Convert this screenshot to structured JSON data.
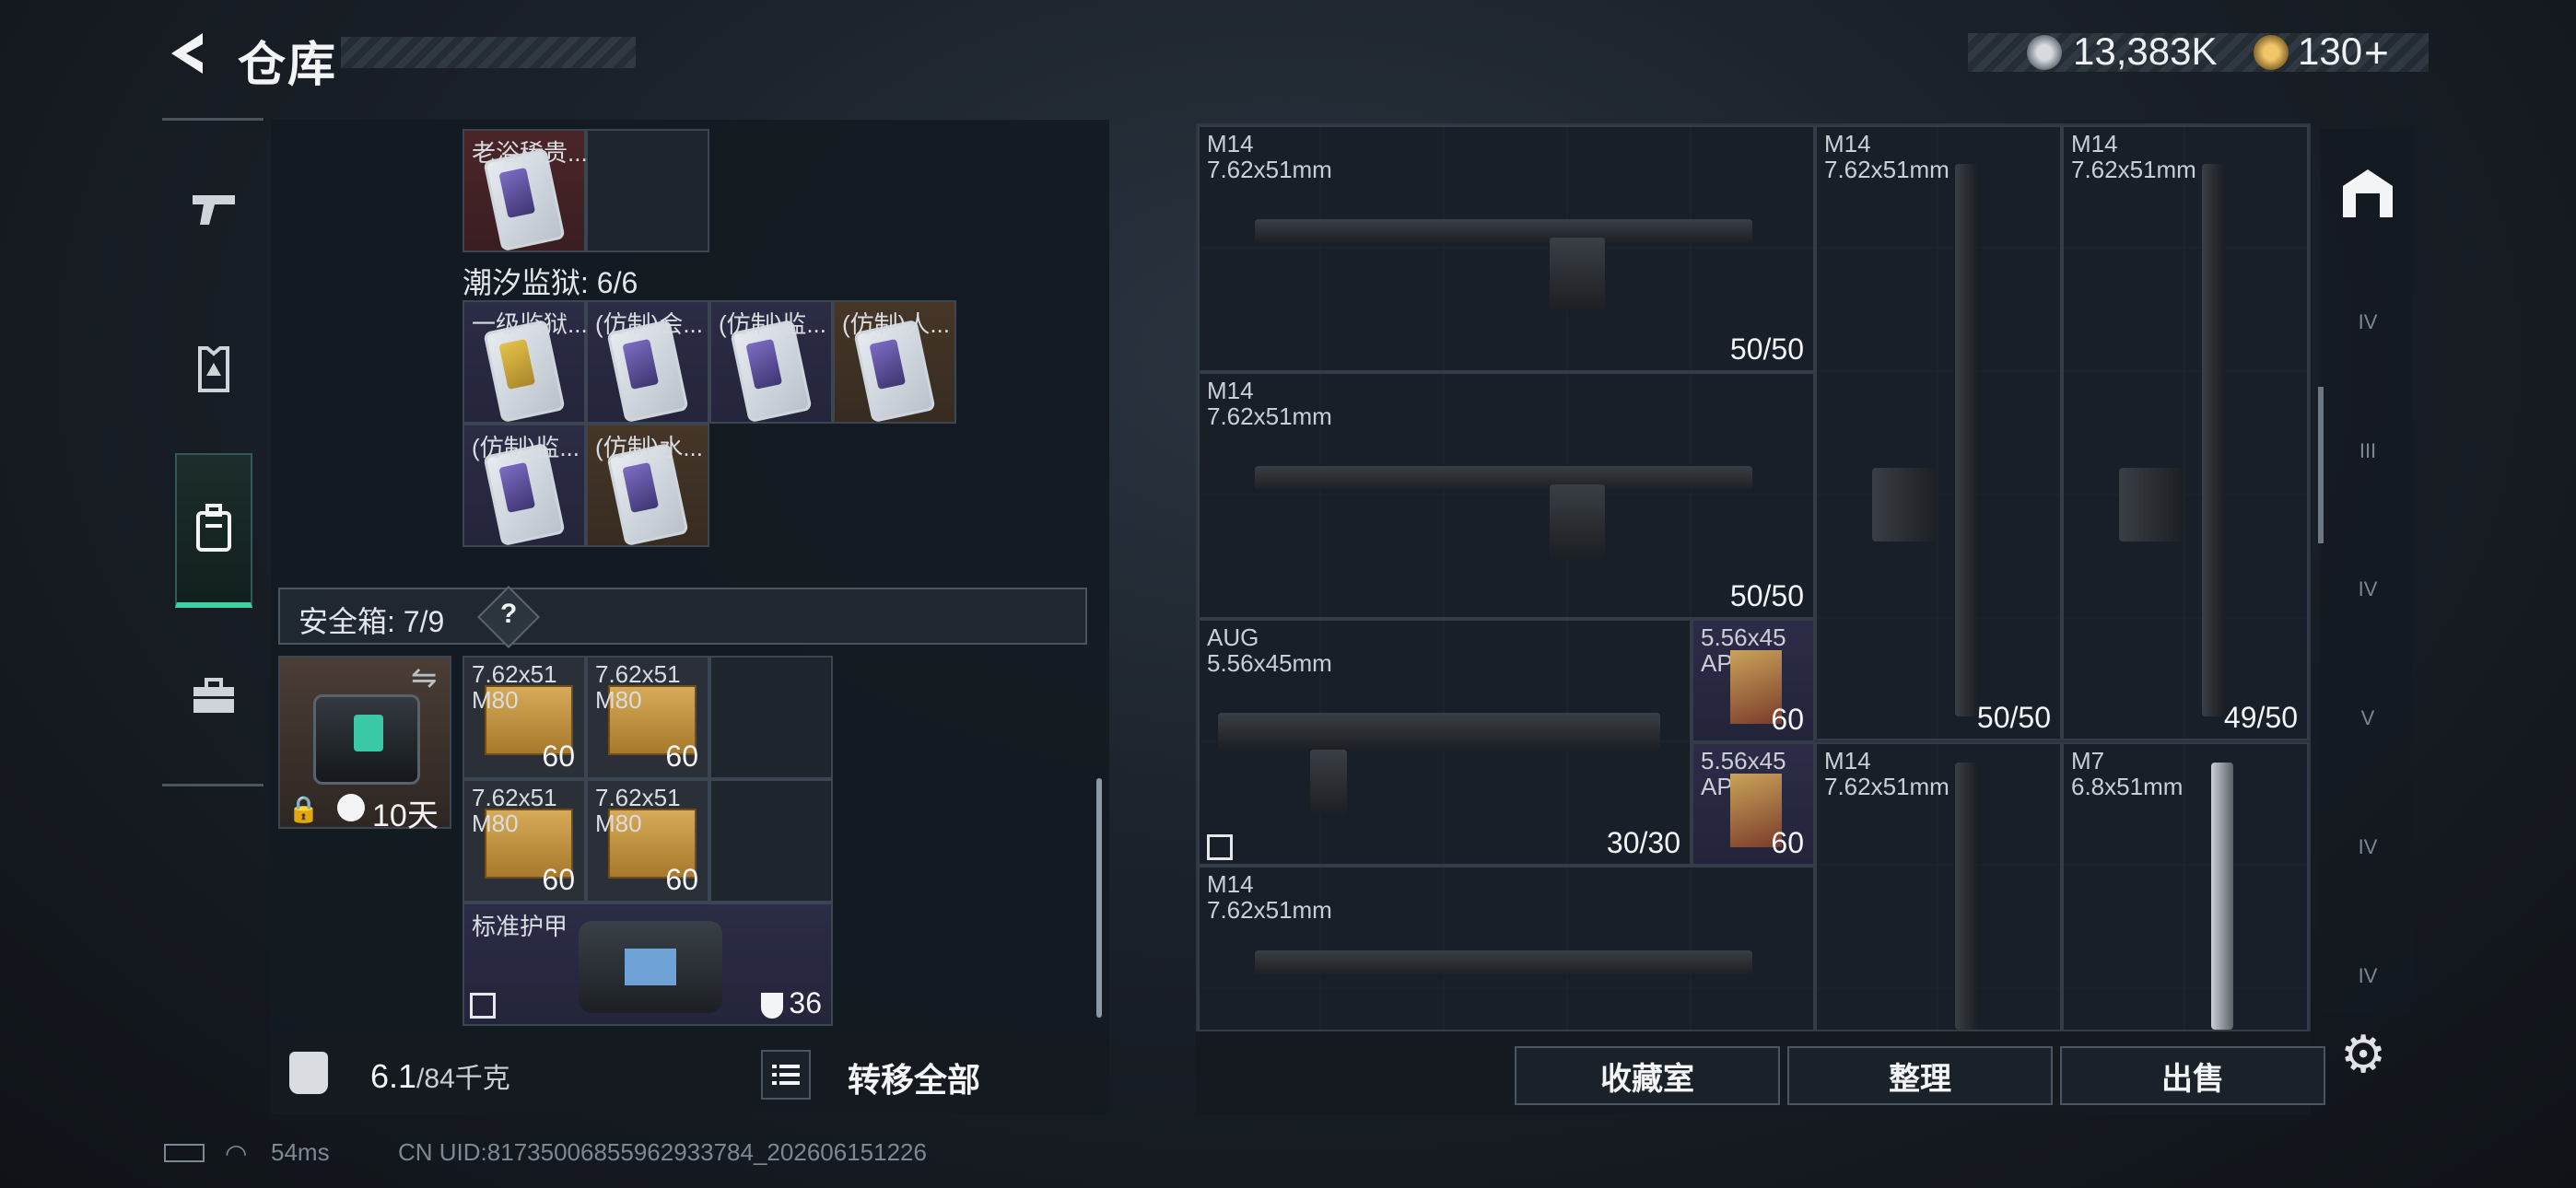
{
  "header": {
    "title": "仓库"
  },
  "currencies": [
    {
      "icon": "silver-coin-icon",
      "value": "13,383K"
    },
    {
      "icon": "gold-coin-icon",
      "value": "130"
    }
  ],
  "left_nav": [
    {
      "name": "weapons",
      "icon": "pistol-icon"
    },
    {
      "name": "gear",
      "icon": "armor-icon"
    },
    {
      "name": "backpack",
      "icon": "backpack-icon",
      "active": true
    },
    {
      "name": "toolbox",
      "icon": "toolbox-icon"
    }
  ],
  "backpack": {
    "top_item": {
      "label": "老浴稀贵..."
    },
    "prison_label": "潮汐监狱: 6/6",
    "prison_items": [
      {
        "label": "一级监狱...",
        "color": "purple",
        "accent": "gold"
      },
      {
        "label": "(仿制)会...",
        "color": "purple"
      },
      {
        "label": "(仿制)监...",
        "color": "purple"
      },
      {
        "label": "(仿制)人...",
        "color": "brown"
      },
      {
        "label": "(仿制)监...",
        "color": "purple"
      },
      {
        "label": "(仿制)水...",
        "color": "brown"
      }
    ],
    "safe_box": {
      "label": "安全箱: 7/9",
      "help": "?",
      "timer": "10天"
    },
    "safe_items": [
      {
        "caliber": "7.62x51",
        "type": "M80",
        "count": "60"
      },
      {
        "caliber": "7.62x51",
        "type": "M80",
        "count": "60"
      },
      {
        "caliber": "7.62x51",
        "type": "M80",
        "count": "60"
      },
      {
        "caliber": "7.62x51",
        "type": "M80",
        "count": "60"
      }
    ],
    "armor": {
      "label": "标准护甲",
      "durability": "36"
    },
    "weight": {
      "current": "6.1",
      "max": "/84千克"
    },
    "transfer_all": "转移全部"
  },
  "stash": {
    "items": [
      {
        "name": "M14",
        "caliber": "7.62x51mm",
        "count": "50/50"
      },
      {
        "name": "M14",
        "caliber": "7.62x51mm",
        "count": "50/50"
      },
      {
        "name": "M14",
        "caliber": "7.62x51mm",
        "count": "49/50"
      },
      {
        "name": "M14",
        "caliber": "7.62x51mm",
        "count": "50/50"
      },
      {
        "name": "AUG",
        "caliber": "5.56x45mm",
        "count": "30/30"
      },
      {
        "name": "5.56x45",
        "caliber": "APC",
        "count": "60"
      },
      {
        "name": "5.56x45",
        "caliber": "APC",
        "count": "60"
      },
      {
        "name": "M14",
        "caliber": "7.62x51mm",
        "count": ""
      },
      {
        "name": "M7",
        "caliber": "6.8x51mm",
        "count": ""
      },
      {
        "name": "M14",
        "caliber": "7.62x51mm",
        "count": ""
      }
    ],
    "buttons": {
      "collection": "收藏室",
      "sort": "整理",
      "sell": "出售"
    }
  },
  "right_filters": [
    "IV",
    "III",
    "IV",
    "V",
    "IV",
    "IV"
  ],
  "status_bar": {
    "ping": "54ms",
    "uid": "CN UID:8173500685596293378​4_202606151226"
  }
}
